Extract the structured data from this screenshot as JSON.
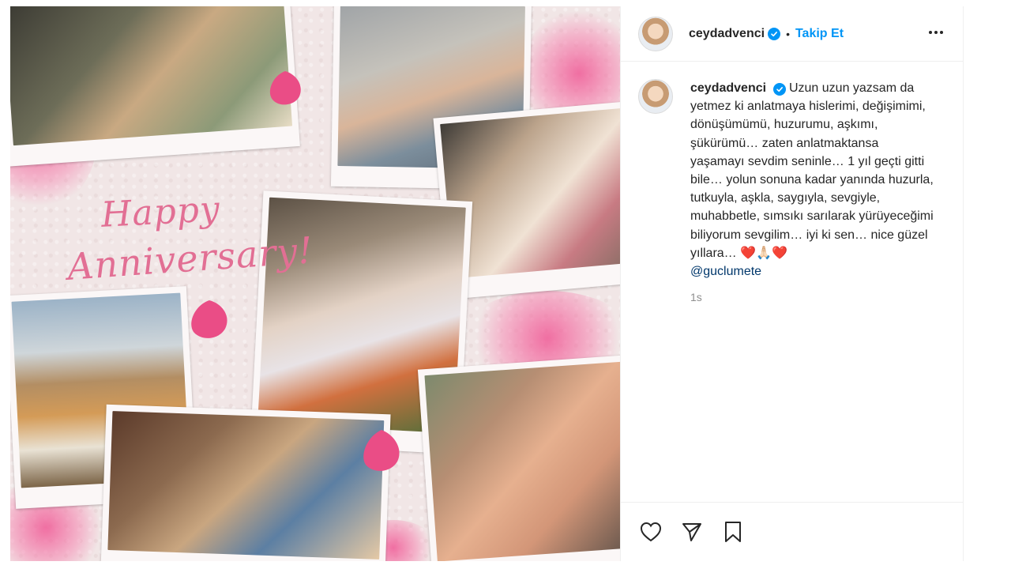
{
  "post": {
    "username": "ceydadvenci",
    "follow_label": "Takip Et",
    "separator": "•",
    "more_icon": "more-horizontal-icon"
  },
  "caption": {
    "username": "ceydadvenci",
    "text": "Uzun uzun yazsam da yetmez ki anlatmaya hislerimi, değişimimi, dönüşümümü, huzurumu, aşkımı, şükürümü… zaten anlatmaktansa yaşamayı sevdim seninle… 1 yıl geçti gitti bile… yolun sonuna kadar yanında huzurla, tutkuyla, aşkla, saygıyla, sevgiyle, muhabbetle, sımsıkı sarılarak yürüyeceğimi biliyorum sevgilim… iyi ki sen… nice güzel yıllara…",
    "emojis": "❤️🙏🏻❤️",
    "mention": "@guclumete",
    "time": "1s"
  },
  "image": {
    "title_line1": "Happy",
    "title_line2": "Anniversary!"
  },
  "actions": {
    "like_icon": "heart-icon",
    "share_icon": "send-icon",
    "save_icon": "bookmark-icon"
  },
  "colors": {
    "accent": "#0095f6",
    "mention": "#00376b",
    "title_pink": "#e26f94"
  }
}
